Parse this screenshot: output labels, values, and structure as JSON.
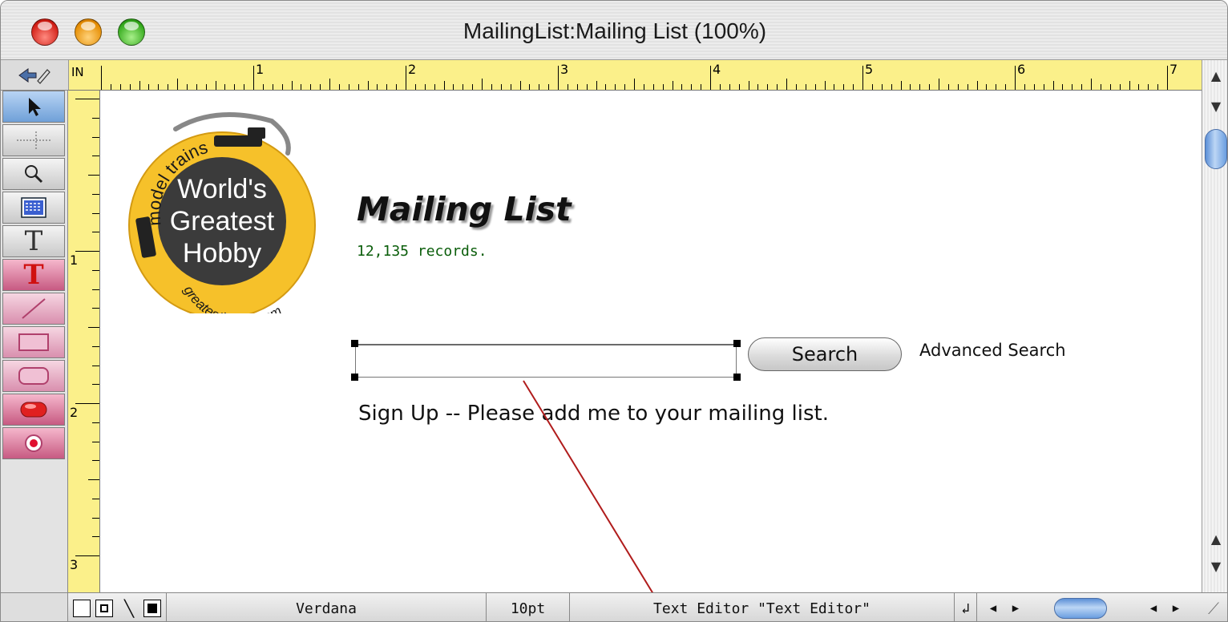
{
  "window": {
    "title": "MailingList:Mailing List (100%)"
  },
  "ruler": {
    "unit": "IN",
    "h_numbers": [
      "1",
      "2",
      "3",
      "4",
      "5",
      "6",
      "7"
    ],
    "v_numbers": [
      "1",
      "2",
      "3"
    ]
  },
  "tools": [
    {
      "name": "pointer-tool-icon"
    },
    {
      "name": "crosshair-tool-icon"
    },
    {
      "name": "magnifier-tool-icon"
    },
    {
      "name": "data-cell-tool-icon"
    },
    {
      "name": "text-tool-icon",
      "glyph": "T"
    },
    {
      "name": "red-text-tool-icon",
      "glyph": "T"
    },
    {
      "name": "line-tool-icon"
    },
    {
      "name": "rectangle-tool-icon"
    },
    {
      "name": "rounded-rectangle-tool-icon"
    },
    {
      "name": "button-tool-icon"
    },
    {
      "name": "radio-button-tool-icon"
    }
  ],
  "logo": {
    "line1": "World's",
    "line2": "Greatest",
    "line3": "Hobby",
    "arc_top": "model trains",
    "arc_bottom": "greatesthobby.com"
  },
  "form": {
    "heading": "Mailing List",
    "records": "12,135 records.",
    "search_value": "",
    "search_button": "Search",
    "advanced_search": "Advanced Search",
    "signup_text": "Sign Up -- Please add me to your mailing list."
  },
  "statusbar": {
    "font": "Verdana",
    "size": "10pt",
    "object": "Text Editor \"Text Editor\"",
    "line_glyph": "╲"
  },
  "colors": {
    "ruler": "#fbf08a",
    "records_text": "#0a5d0a",
    "connector_line": "#b01c1c",
    "logo_ring": "#f6c12a",
    "logo_center": "#3b3b3b"
  }
}
